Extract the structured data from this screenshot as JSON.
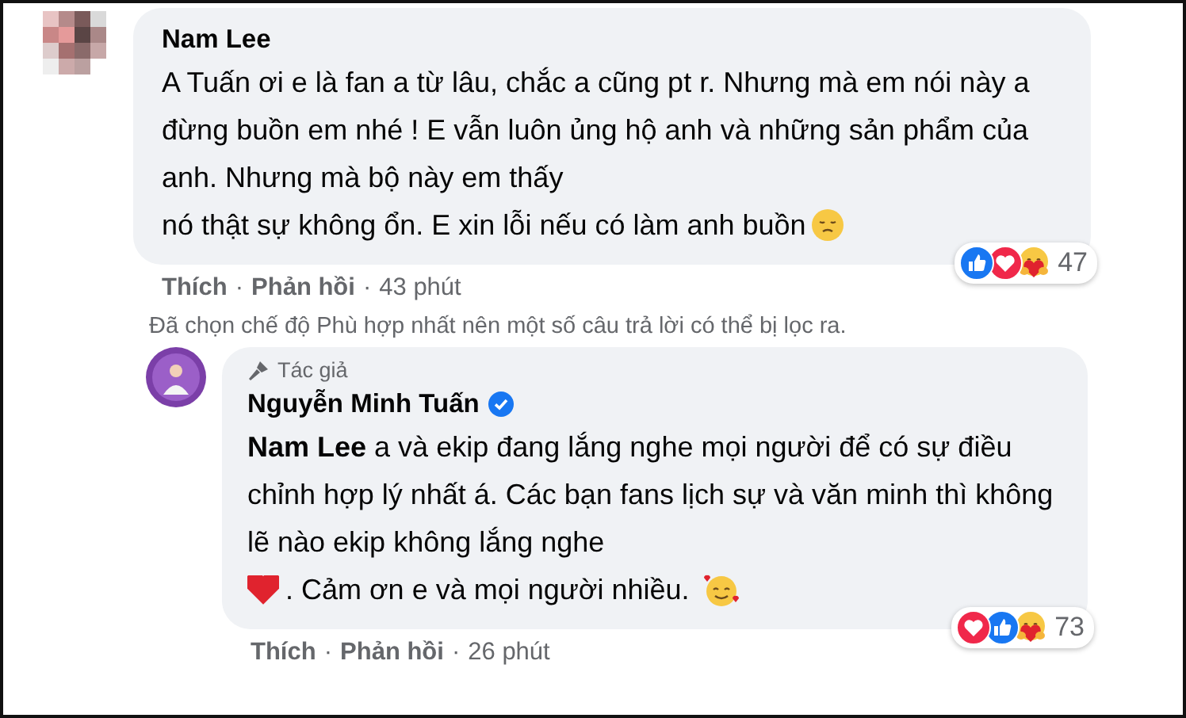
{
  "comments": [
    {
      "author": "Nam Lee",
      "verified": false,
      "body": [
        {
          "parts": [
            {
              "kind": "text",
              "text": "A Tuấn ơi e là fan a từ lâu, chắc a cũng pt r. Nhưng mà em nói này a đừng buồn em nhé ! E vẫn luôn ủng hộ anh và những sản phẩm của anh. Nhưng mà bộ này em thấy"
            }
          ]
        },
        {
          "parts": [
            {
              "kind": "text",
              "text": "nó thật sự không ổn. E xin lỗi nếu có làm anh buồn"
            },
            {
              "kind": "sad"
            }
          ]
        }
      ],
      "reactions": [
        {
          "kind": "like"
        },
        {
          "kind": "love"
        },
        {
          "kind": "care"
        }
      ],
      "reaction_count": "47",
      "actions": [
        "Thích",
        "Phản hồi"
      ],
      "separator": "·",
      "time": "43 phút",
      "reply": false
    },
    {
      "notice": "Đã chọn chế độ Phù hợp nhất nên một số câu trả lời có thể bị lọc ra."
    },
    {
      "author": "Nguyễn Minh Tuấn",
      "author_badge": "Tác giả",
      "verified": true,
      "body": [
        {
          "parts": [
            {
              "kind": "text",
              "text": "**Nam Lee** a và ekip đang lắng nghe mọi người để có sự điều chỉnh hợp lý nhất á. Các bạn fans lịch sự và văn minh thì không lẽ nào ekip không lắng nghe"
            }
          ]
        },
        {
          "parts": [
            {
              "kind": "heart"
            },
            {
              "kind": "text",
              "text": ". Cảm ơn e và mọi người nhiều."
            },
            {
              "kind": "hearts"
            }
          ]
        }
      ],
      "reactions": [
        {
          "kind": "love"
        },
        {
          "kind": "like"
        },
        {
          "kind": "care"
        }
      ],
      "reaction_count": "73",
      "actions": [
        "Thích",
        "Phản hồi"
      ],
      "separator": "·",
      "time": "26 phút",
      "reply": true
    }
  ]
}
